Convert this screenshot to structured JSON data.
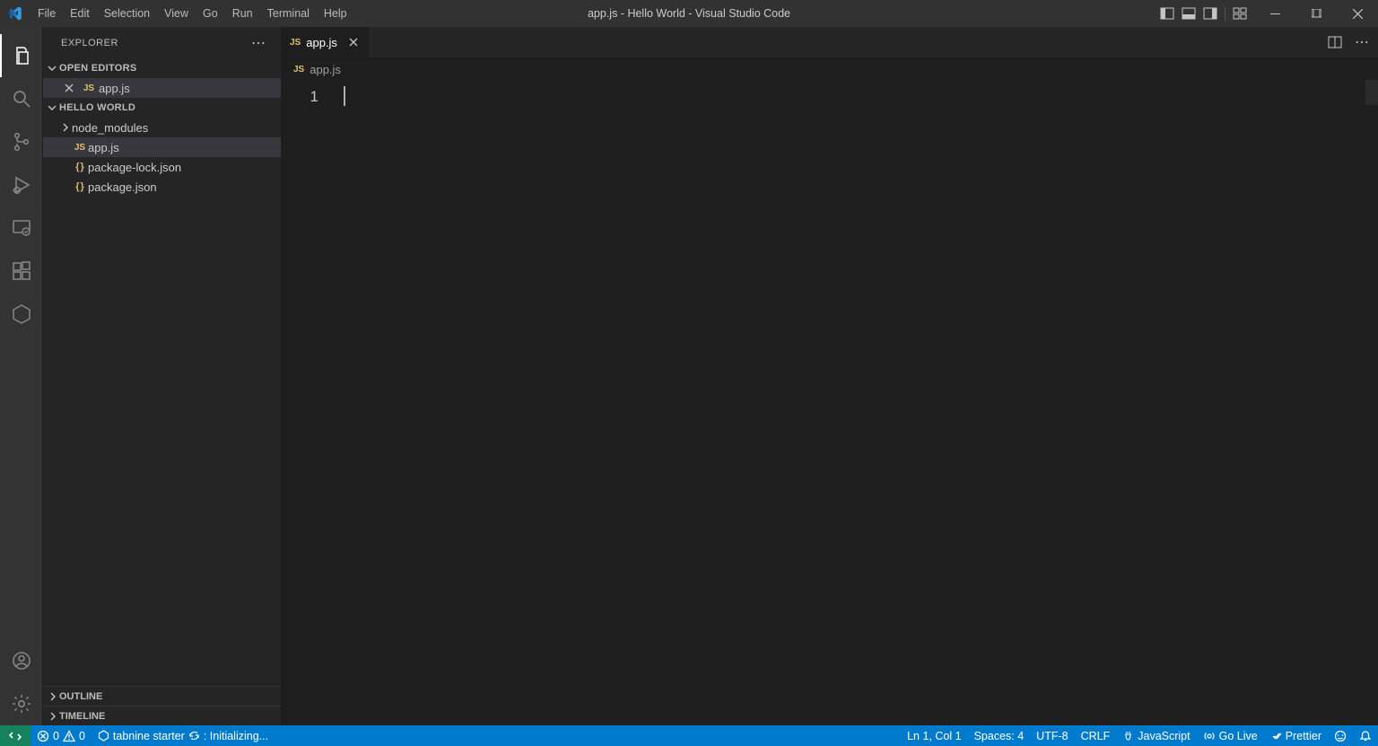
{
  "title": "app.js - Hello World - Visual Studio Code",
  "menubar": [
    "File",
    "Edit",
    "Selection",
    "View",
    "Go",
    "Run",
    "Terminal",
    "Help"
  ],
  "sidebar": {
    "title": "EXPLORER",
    "open_editors_label": "OPEN EDITORS",
    "open_editors": [
      {
        "label": "app.js",
        "icon": "js"
      }
    ],
    "workspace_label": "HELLO WORLD",
    "files": [
      {
        "label": "node_modules",
        "icon": "folder",
        "chev": true
      },
      {
        "label": "app.js",
        "icon": "js",
        "selected": true
      },
      {
        "label": "package-lock.json",
        "icon": "json"
      },
      {
        "label": "package.json",
        "icon": "json"
      }
    ],
    "outline_label": "OUTLINE",
    "timeline_label": "TIMELINE"
  },
  "tab": {
    "label": "app.js"
  },
  "breadcrumb": {
    "file": "app.js"
  },
  "editor": {
    "line_no": "1"
  },
  "statusbar": {
    "errors": "0",
    "warnings": "0",
    "tabnine": "tabnine starter",
    "initializing": ": Initializing...",
    "position": "Ln 1, Col 1",
    "spaces": "Spaces: 4",
    "encoding": "UTF-8",
    "eol": "CRLF",
    "language": "JavaScript",
    "golive": "Go Live",
    "prettier": "Prettier"
  }
}
